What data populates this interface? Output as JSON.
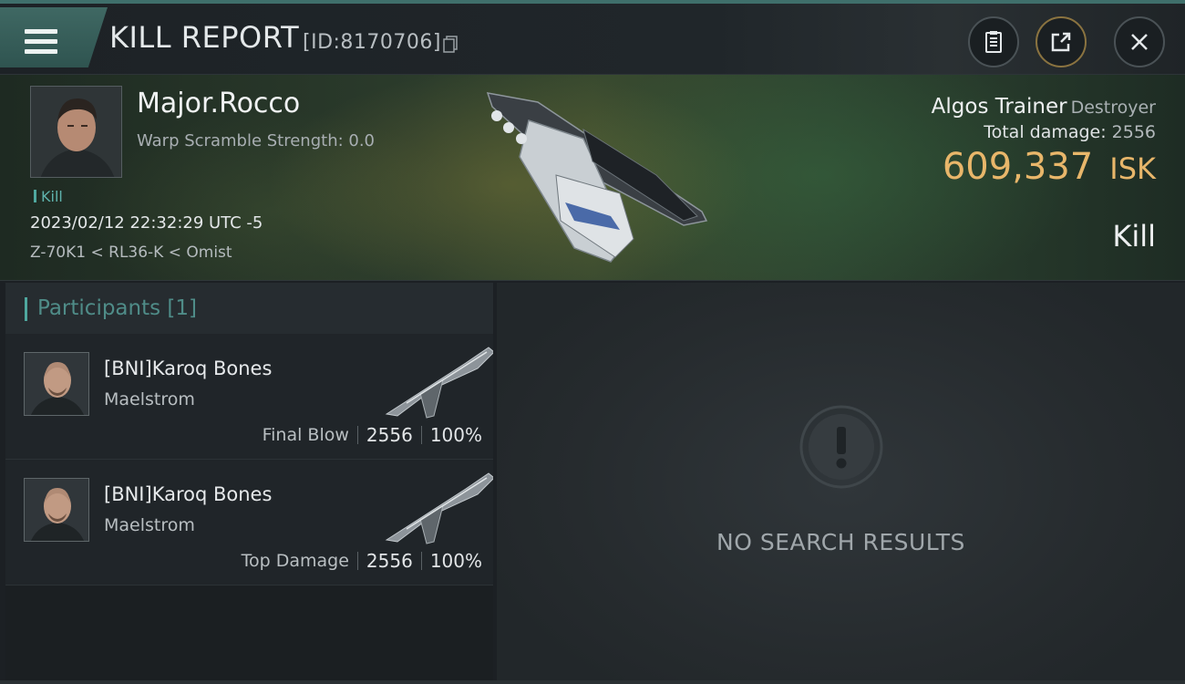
{
  "header": {
    "title": "KILL REPORT",
    "id_text": "[ID:8170706]",
    "icons": [
      "menu-icon",
      "copy-icon",
      "clipboard-icon",
      "share-icon",
      "close-icon"
    ]
  },
  "victim": {
    "name": "Major.Rocco",
    "warp_scramble": "Warp Scramble Strength: 0.0",
    "tag": "Kill",
    "datetime": "2023/02/12 22:32:29 UTC -5",
    "location": "Z-70K1 < RL36-K < Omist",
    "ship_name": "Algos Trainer",
    "ship_class": "Destroyer",
    "total_damage_label": "Total damage:",
    "total_damage": "2556",
    "isk_value": "609,337",
    "isk_unit": "ISK",
    "result": "Kill"
  },
  "participants": {
    "title": "Participants [1]",
    "rows": [
      {
        "name": "[BNI]Karoq Bones",
        "ship": "Maelstrom",
        "label": "Final Blow",
        "damage": "2556",
        "percent": "100%"
      },
      {
        "name": "[BNI]Karoq Bones",
        "ship": "Maelstrom",
        "label": "Top Damage",
        "damage": "2556",
        "percent": "100%"
      }
    ]
  },
  "empty_state": {
    "message": "NO SEARCH RESULTS",
    "icon": "alert-icon"
  },
  "colors": {
    "accent": "#4fa89f",
    "isk": "#e8b66a",
    "background": "#1c2024"
  }
}
